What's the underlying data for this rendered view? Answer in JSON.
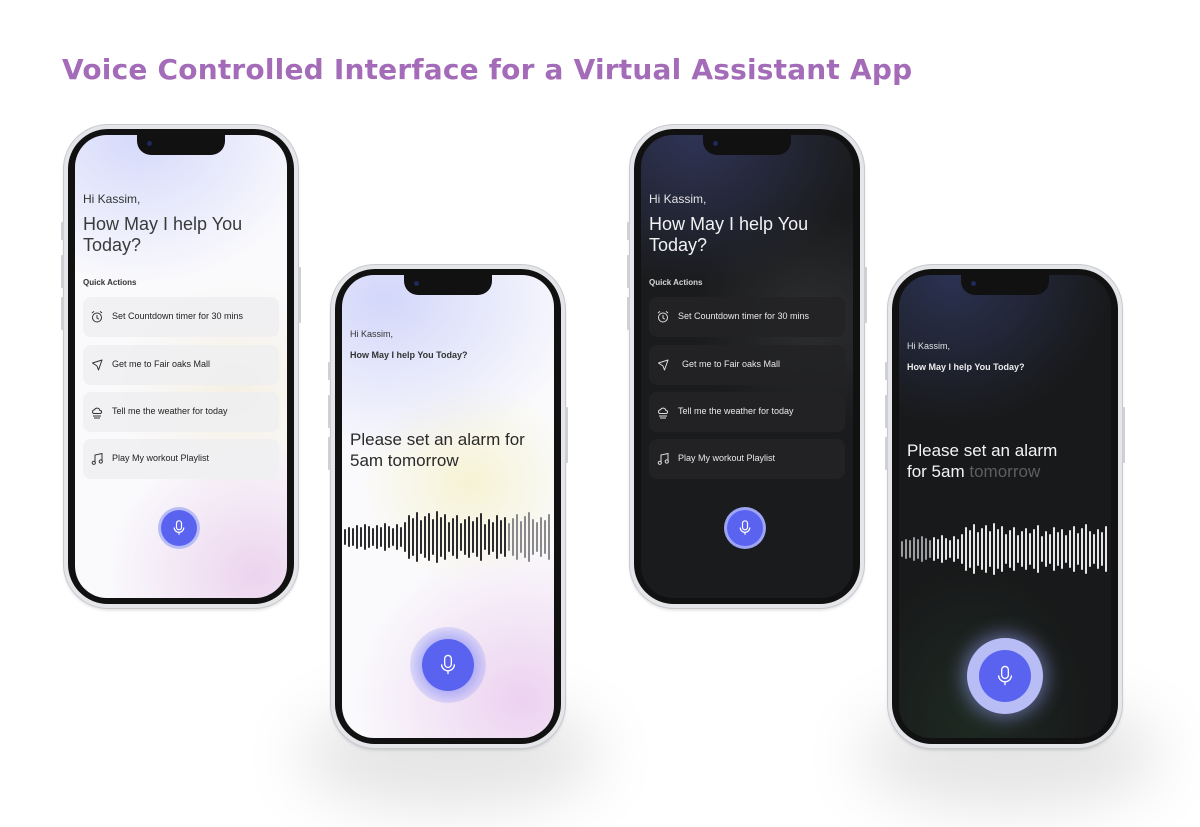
{
  "page_title": "Voice Controlled Interface for a Virtual Assistant App",
  "colors": {
    "title": "#a36bb8",
    "mic_accent": "#5a63f0"
  },
  "screens": {
    "light_home": {
      "greeting": "Hi Kassim,",
      "prompt": "How May I help You Today?",
      "quick_actions_label": "Quick Actions",
      "actions": [
        {
          "icon": "alarm-clock-icon",
          "label": "Set Countdown timer for 30 mins"
        },
        {
          "icon": "navigation-arrow-icon",
          "label": "Get me to Fair oaks Mall"
        },
        {
          "icon": "weather-cloud-icon",
          "label": "Tell me the weather for today"
        },
        {
          "icon": "music-note-icon",
          "label": "Play My workout Playlist"
        }
      ],
      "mic_icon": "microphone-icon"
    },
    "light_listening": {
      "greeting": "Hi Kassim,",
      "prompt": "How May I help You Today?",
      "transcript": "Please set an alarm for 5am tomorrow",
      "mic_icon": "microphone-icon"
    },
    "dark_home": {
      "greeting": "Hi Kassim,",
      "prompt": "How May I help You Today?",
      "quick_actions_label": "Quick Actions",
      "actions": [
        {
          "icon": "alarm-clock-icon",
          "label": "Set Countdown timer for 30 mins"
        },
        {
          "icon": "navigation-arrow-icon",
          "label": "Get me to Fair oaks Mall"
        },
        {
          "icon": "weather-cloud-icon",
          "label": "Tell me the weather for today"
        },
        {
          "icon": "music-note-icon",
          "label": "Play My workout Playlist"
        }
      ],
      "mic_icon": "microphone-icon"
    },
    "dark_listening": {
      "greeting": "Hi Kassim,",
      "prompt": "How May I help You Today?",
      "transcript_line1": "Please set an alarm",
      "transcript_line2_lead": "for 5am",
      "transcript_line2_fading": "tomorrow",
      "mic_icon": "microphone-icon"
    }
  }
}
